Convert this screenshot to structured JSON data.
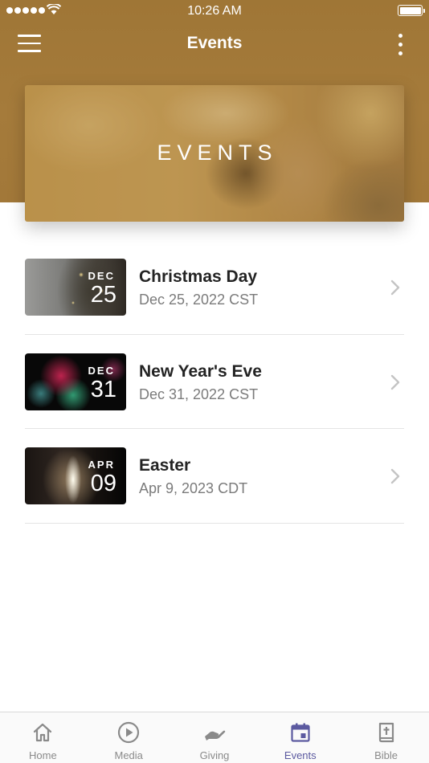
{
  "status_bar": {
    "time": "10:26 AM",
    "icons": [
      "signal-dots-icon",
      "wifi-icon",
      "battery-icon"
    ]
  },
  "nav_bar": {
    "title": "Events",
    "left_icon": "hamburger-menu-icon",
    "right_icon": "more-vertical-icon"
  },
  "hero": {
    "title": "EVENTS"
  },
  "events": [
    {
      "month": "DEC",
      "day": "25",
      "title": "Christmas Day",
      "date": "Dec 25, 2022 CST",
      "image": "christmas-tree-image"
    },
    {
      "month": "DEC",
      "day": "31",
      "title": "New Year's Eve",
      "date": "Dec 31, 2022 CST",
      "image": "fireworks-image"
    },
    {
      "month": "APR",
      "day": "09",
      "title": "Easter",
      "date": "Apr 9, 2023 CDT",
      "image": "empty-tomb-image"
    }
  ],
  "tab_bar": {
    "tabs": [
      {
        "label": "Home",
        "icon": "home-icon",
        "active": false
      },
      {
        "label": "Media",
        "icon": "play-circle-icon",
        "active": false
      },
      {
        "label": "Giving",
        "icon": "giving-hand-icon",
        "active": false
      },
      {
        "label": "Events",
        "icon": "calendar-icon",
        "active": true
      },
      {
        "label": "Bible",
        "icon": "bible-book-icon",
        "active": false
      }
    ]
  },
  "colors": {
    "header_brown": "#a27839",
    "active_tab": "#5c5aa0",
    "inactive_tab": "#8a8a8a"
  }
}
